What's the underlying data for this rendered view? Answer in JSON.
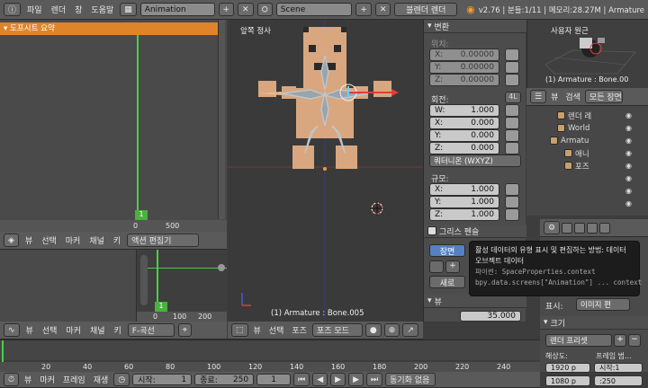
{
  "topbar": {
    "menus": [
      "파일",
      "렌더",
      "창",
      "도움말"
    ],
    "screen_layout": "Animation",
    "scene": "Scene",
    "render_engine": "블렌더 렌더",
    "status": "v2.76 | 분들:1/11 | 메모리:28.27M | Armature"
  },
  "dopesheet": {
    "channel_label": "도프시트 요약",
    "current_frame": "1",
    "ruler": [
      "0",
      "500"
    ],
    "menus": [
      "뷰",
      "선택",
      "마커",
      "채널",
      "키"
    ],
    "mode": "액션 편집기"
  },
  "graph": {
    "current_frame": "1",
    "ruler": [
      "0",
      "100",
      "200"
    ],
    "menus": [
      "뷰",
      "선택",
      "마커",
      "채널",
      "키"
    ],
    "mode": "F-곡선"
  },
  "viewport": {
    "view_label": "앞쪽 정사",
    "object_info": "(1) Armature : Bone.005",
    "menus": [
      "뷰",
      "선택",
      "포즈"
    ],
    "mode": "포즈 모드"
  },
  "properties": {
    "transform_title": "변환",
    "location_label": "위치:",
    "location": [
      {
        "axis": "X:",
        "value": "0.00000"
      },
      {
        "axis": "Y:",
        "value": "0.00000"
      },
      {
        "axis": "Z:",
        "value": "0.00000"
      }
    ],
    "rotation_label": "회전:",
    "rotation_mode_badge": "4L",
    "rotation": [
      {
        "axis": "W:",
        "value": "1.000"
      },
      {
        "axis": "X:",
        "value": "0.000"
      },
      {
        "axis": "Y:",
        "value": "0.000"
      },
      {
        "axis": "Z:",
        "value": "0.000"
      }
    ],
    "rotation_mode": "쿼터니온 (WXYZ)",
    "scale_label": "규모:",
    "scale": [
      {
        "axis": "X:",
        "value": "1.000"
      },
      {
        "axis": "Y:",
        "value": "1.000"
      },
      {
        "axis": "Z:",
        "value": "1.000"
      }
    ],
    "grease_title": "그리스 펜슬",
    "tab_scene": "장면",
    "new_button": "새로",
    "view_title": "뷰",
    "lens_value": "35.000"
  },
  "tooltip": {
    "line1": "활성 데이터의 유형 표시 및 편집하는 방법: 데이터",
    "line2": "오브젝트 데이터",
    "line3": "파이썬: SpaceProperties.context",
    "line4": "bpy.data.screens[\"Animation\"] ... context"
  },
  "camera_view": {
    "label": "사용자 원근",
    "info": "(1) Armature : Bone.00"
  },
  "outliner": {
    "menus": [
      "뷰",
      "검색"
    ],
    "filter": "모든 장면",
    "items": [
      "렌더 레",
      "World",
      "Armatu",
      "애니",
      "포즈"
    ]
  },
  "render_props": {
    "display_label": "표시:",
    "display_value": "이미지 편",
    "size_title": "크기",
    "preset": "렌더 프리셋",
    "resolution_label": "해상도:",
    "frame_range_label": "프레임 범...",
    "res_x": "1920 p",
    "res_y": "1080 p",
    "start_small": "시작:1",
    "end_small": ":250"
  },
  "timeline": {
    "ticks": [
      "20",
      "40",
      "60",
      "80",
      "100",
      "120",
      "140",
      "160",
      "180",
      "200",
      "220",
      "240"
    ],
    "menus": [
      "뷰",
      "마커",
      "프레임",
      "재생"
    ],
    "start": "시작:",
    "start_value": "1",
    "end": "종료:",
    "end_value": "250",
    "frame": "1",
    "sync": "동기화 없음"
  }
}
